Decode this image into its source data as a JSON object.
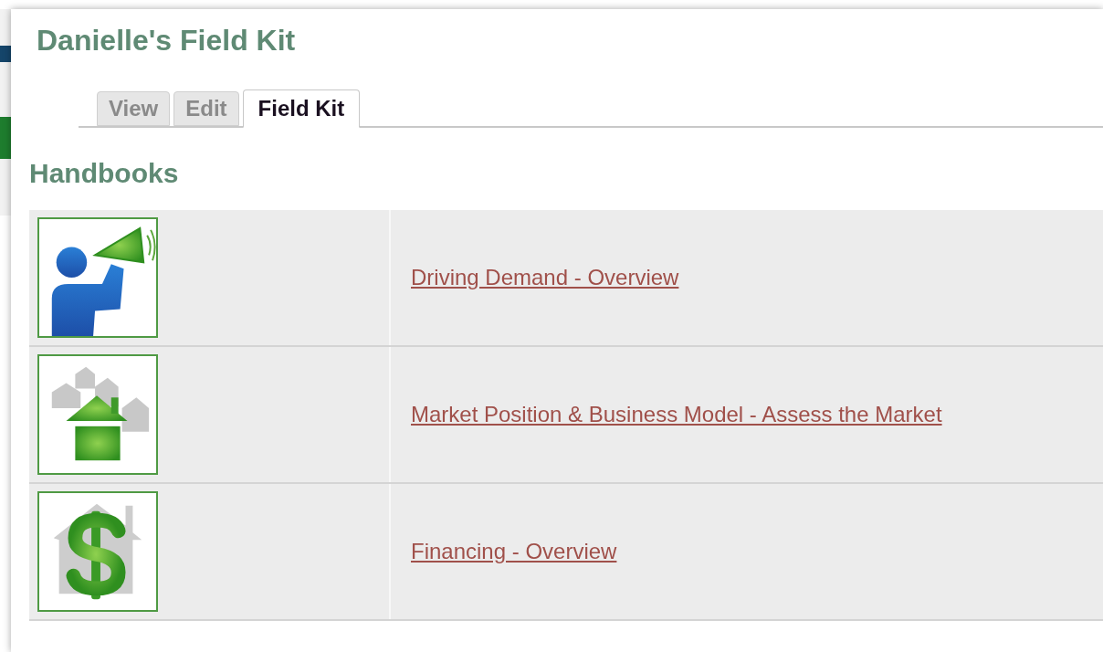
{
  "page_title": "Danielle's Field Kit",
  "tabs": [
    {
      "label": "View",
      "selected": false
    },
    {
      "label": "Edit",
      "selected": false
    },
    {
      "label": "Field Kit",
      "selected": true
    }
  ],
  "section_title": "Handbooks",
  "handbooks": [
    {
      "kind": "megaphone",
      "link": "Driving Demand - Overview"
    },
    {
      "kind": "houses",
      "link": "Market Position & Business Model - Assess the Market"
    },
    {
      "kind": "dollar",
      "link": "Financing - Overview"
    }
  ]
}
